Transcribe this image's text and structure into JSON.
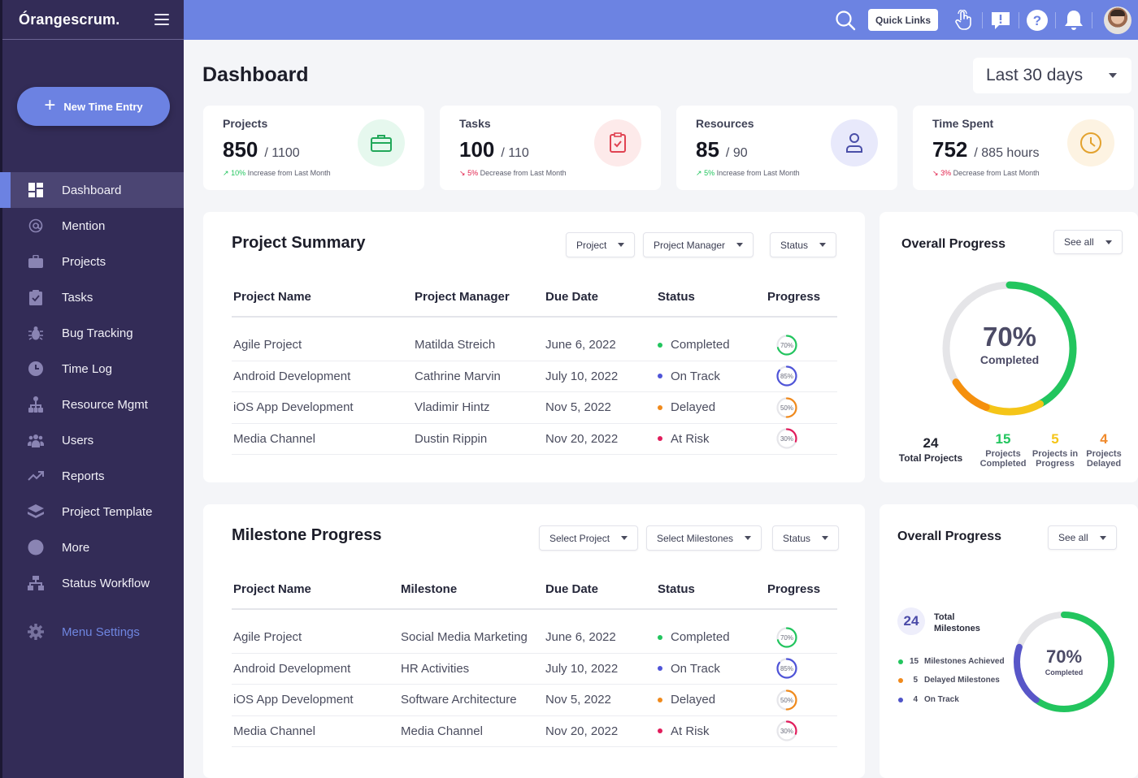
{
  "app": {
    "brand": "Órangescrum.",
    "new_time_entry": "New Time Entry"
  },
  "sidebar": {
    "items": [
      {
        "label": "Dashboard",
        "icon": "dashboard-icon",
        "active": true
      },
      {
        "label": "Mention",
        "icon": "at-icon"
      },
      {
        "label": "Projects",
        "icon": "briefcase-icon"
      },
      {
        "label": "Tasks",
        "icon": "clipboard-check-icon"
      },
      {
        "label": "Bug Tracking",
        "icon": "bug-icon"
      },
      {
        "label": "Time Log",
        "icon": "clock-icon"
      },
      {
        "label": "Resource Mgmt",
        "icon": "org-chart-icon"
      },
      {
        "label": "Users",
        "icon": "users-icon"
      },
      {
        "label": "Reports",
        "icon": "trend-icon"
      },
      {
        "label": "Project Template",
        "icon": "layers-icon"
      },
      {
        "label": "More",
        "icon": "circle-icon"
      },
      {
        "label": "Status Workflow",
        "icon": "workflow-icon"
      }
    ],
    "settings": {
      "label": "Menu Settings",
      "icon": "gear-icon"
    }
  },
  "topbar": {
    "quick_links": "Quick Links",
    "icons": [
      "search-icon",
      "hand-pointer-icon",
      "feedback-icon",
      "help-icon",
      "bell-icon",
      "avatar"
    ]
  },
  "page": {
    "title": "Dashboard",
    "range": "Last 30 days"
  },
  "stats": [
    {
      "label": "Projects",
      "value": "850",
      "total": "/ 1100",
      "trend_dir": "up",
      "trend_pct": "10%",
      "trend_text": "Increase from Last Month",
      "icon": "briefcase-icon",
      "color": "#22a85a",
      "bg": "#e6f8ee"
    },
    {
      "label": "Tasks",
      "value": "100",
      "total": "/ 110",
      "trend_dir": "down",
      "trend_pct": "5%",
      "trend_text": "Decrease from Last Month",
      "icon": "clipboard-check-icon",
      "color": "#e04352",
      "bg": "#fdeaea"
    },
    {
      "label": "Resources",
      "value": "85",
      "total": "/ 90",
      "trend_dir": "up",
      "trend_pct": "5%",
      "trend_text": "Increase from Last Month",
      "icon": "user-icon",
      "color": "#4a4fa8",
      "bg": "#e8e9fb"
    },
    {
      "label": "Time Spent",
      "value": "752",
      "total": "/ 885  hours",
      "trend_dir": "down",
      "trend_pct": "3%",
      "trend_text": "Decrease from Last Month",
      "icon": "clock-icon",
      "color": "#e3a22e",
      "bg": "#fdf3e2"
    }
  ],
  "project_summary": {
    "title": "Project Summary",
    "filters": [
      "Project",
      "Project Manager",
      "Status"
    ],
    "columns": [
      "Project Name",
      "Project Manager",
      "Due Date",
      "Status",
      "Progress"
    ],
    "rows": [
      {
        "name": "Agile Project",
        "manager": "Matilda Streich",
        "due": "June 6, 2022",
        "status": "Completed",
        "status_color": "#22c55e",
        "progress": 70,
        "progress_label": "70%"
      },
      {
        "name": "Android Development",
        "manager": "Cathrine Marvin",
        "due": "July 10, 2022",
        "status": "On Track",
        "status_color": "#4f54d8",
        "progress": 85,
        "progress_label": "85%"
      },
      {
        "name": "iOS App Development",
        "manager": "Vladimir Hintz",
        "due": "Nov 5, 2022",
        "status": "Delayed",
        "status_color": "#f08a1c",
        "progress": 50,
        "progress_label": "50%"
      },
      {
        "name": "Media Channel",
        "manager": "Dustin Rippin",
        "due": "Nov 20, 2022",
        "status": "At Risk",
        "status_color": "#e11d5c",
        "progress": 30,
        "progress_label": "30%"
      }
    ]
  },
  "milestone_progress": {
    "title": "Milestone Progress",
    "filters": [
      "Select Project",
      "Select Milestones",
      "Status"
    ],
    "columns": [
      "Project Name",
      "Milestone",
      "Due Date",
      "Status",
      "Progress"
    ],
    "rows": [
      {
        "name": "Agile Project",
        "milestone": "Social Media Marketing",
        "due": "June 6, 2022",
        "status": "Completed",
        "status_color": "#22c55e",
        "progress": 70,
        "progress_label": "70%"
      },
      {
        "name": "Android Development",
        "milestone": "HR Activities",
        "due": "July 10, 2022",
        "status": "On Track",
        "status_color": "#4f54d8",
        "progress": 85,
        "progress_label": "85%"
      },
      {
        "name": "iOS App Development",
        "milestone": "Software Architecture",
        "due": "Nov 5, 2022",
        "status": "Delayed",
        "status_color": "#f08a1c",
        "progress": 50,
        "progress_label": "50%"
      },
      {
        "name": "Media Channel",
        "milestone": "Media Channel",
        "due": "Nov 20, 2022",
        "status": "At Risk",
        "status_color": "#e11d5c",
        "progress": 30,
        "progress_label": "30%"
      }
    ]
  },
  "overall_projects": {
    "title": "Overall Progress",
    "see_all": "See all",
    "percent": "70%",
    "percent_label": "Completed",
    "segments": [
      {
        "name": "Completed",
        "fraction": 0.42,
        "color": "#22c55e"
      },
      {
        "name": "In Progress",
        "fraction": 0.14,
        "color": "#f5c518"
      },
      {
        "name": "Delayed",
        "fraction": 0.1,
        "color": "#f5900e"
      }
    ],
    "total": {
      "value": "24",
      "label": "Total Projects"
    },
    "breakdown": [
      {
        "value": "15",
        "label_1": "Projects",
        "label_2": "Completed",
        "color": "#22c55e"
      },
      {
        "value": "5",
        "label_1": "Projects in",
        "label_2": "Progress",
        "color": "#f5c518"
      },
      {
        "value": "4",
        "label_1": "Projects",
        "label_2": "Delayed",
        "color": "#f08a2c"
      }
    ]
  },
  "overall_milestones": {
    "title": "Overall Progress",
    "see_all": "See all",
    "percent": "70%",
    "percent_label": "Completed",
    "total": {
      "value": "24",
      "label_1": "Total",
      "label_2": "Milestones"
    },
    "segments": [
      {
        "name": "Milestones Achieved",
        "fraction": 0.6,
        "color": "#22c55e"
      },
      {
        "name": "On Track",
        "fraction": 0.2,
        "color": "#5856c8"
      }
    ],
    "legend": [
      {
        "value": "15",
        "label": "Milestones Achieved",
        "color": "#22c55e"
      },
      {
        "value": "5",
        "label": "Delayed Milestones",
        "color": "#f08a1c"
      },
      {
        "value": "4",
        "label": "On Track",
        "color": "#4f54c8"
      }
    ]
  }
}
